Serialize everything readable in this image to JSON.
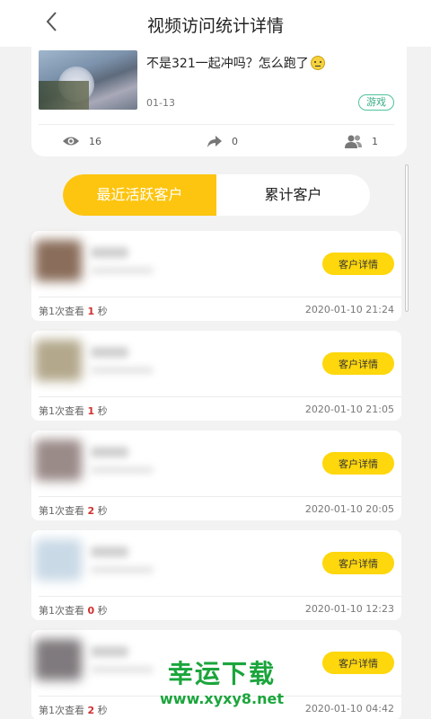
{
  "header": {
    "title": "视频访问统计详情"
  },
  "video": {
    "title": "不是321一起冲吗？怎么跑了",
    "date": "01-13",
    "tag": "游戏",
    "views": "16",
    "shares": "0",
    "visitors": "1"
  },
  "tabs": {
    "active": "最近活跃客户",
    "inactive": "累计客户"
  },
  "customers": [
    {
      "detail_label": "客户详情",
      "view_prefix": "第1次查看",
      "view_seconds": "1",
      "view_unit": "秒",
      "time": "2020-01-10 21:24",
      "avatar_color": "#8a6d5a"
    },
    {
      "detail_label": "客户详情",
      "view_prefix": "第1次查看",
      "view_seconds": "1",
      "view_unit": "秒",
      "time": "2020-01-10 21:05",
      "avatar_color": "#b3a88c"
    },
    {
      "detail_label": "客户详情",
      "view_prefix": "第1次查看",
      "view_seconds": "2",
      "view_unit": "秒",
      "time": "2020-01-10 20:05",
      "avatar_color": "#9a8a88"
    },
    {
      "detail_label": "客户详情",
      "view_prefix": "第1次查看",
      "view_seconds": "0",
      "view_unit": "秒",
      "time": "2020-01-10 12:23",
      "avatar_color": "#c9d9e6"
    },
    {
      "detail_label": "客户详情",
      "view_prefix": "第1次查看",
      "view_seconds": "2",
      "view_unit": "秒",
      "time": "2020-01-10 04:42",
      "avatar_color": "#7f7a7d"
    }
  ],
  "watermark": {
    "main": "幸运下载",
    "url": "www.xyxy8.net"
  },
  "colors": {
    "accent": "#fdc510",
    "button": "#fed70c",
    "tag": "#3cae87",
    "highlight": "#d0302f"
  }
}
